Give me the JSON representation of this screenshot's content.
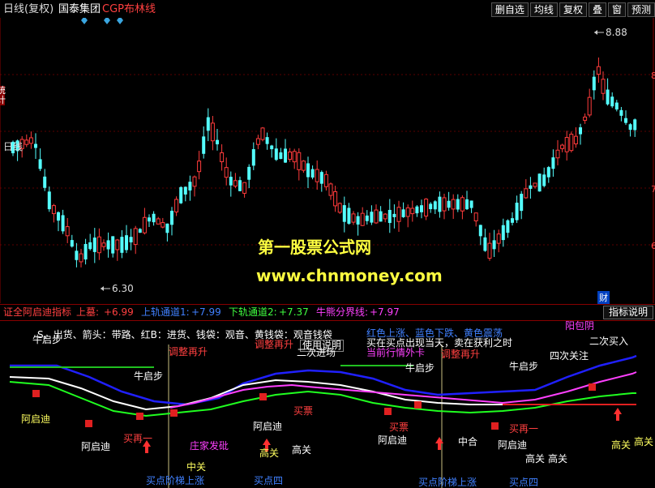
{
  "topbar": {
    "period_label": "日线(复权)",
    "stock_name": "国泰集团",
    "indicator_name": "CGP布林线",
    "toolbar": [
      "删自选",
      "均线",
      "复权",
      "叠",
      "窗",
      "预测"
    ]
  },
  "main_chart": {
    "high_label": "8.88",
    "low_label": "6.30",
    "left_edge_chars": [
      "日线",
      "统",
      "计"
    ],
    "finance_marker": "财",
    "right_ticks": [
      "8",
      "7",
      "6"
    ],
    "colors": {
      "up": "#ff3b3b",
      "down": "#54ffff"
    }
  },
  "watermark": {
    "line1": "第一股票公式网",
    "line2": "www.chnmoney.com"
  },
  "indicator_bar": {
    "name": "证全阿启迪指标",
    "upper_label": "上墓:",
    "upper_value": "+6.99",
    "ch1_label": "上轨通道1:",
    "ch1_value": "+7.99",
    "ch2_label": "下轨通道2:",
    "ch2_value": "+7.37",
    "bull_label": "牛熊分界线:",
    "bull_value": "+7.97",
    "button": "指标说明"
  },
  "sub_chart": {
    "legend_left": "S、出货、箭头：带路、红B：进货、钱袋：观音、黄钱袋：观音钱袋",
    "legend_usage": "使用说明",
    "legend_right1": "红色上涨、蓝色下跌、黄色震荡",
    "legend_right2": "买在买点出现当天，卖在获利之时",
    "legend_right3": "当前行情外卡",
    "labels": [
      {
        "t": "牛启步",
        "c": "#ffffff"
      },
      {
        "t": "调整再升",
        "c": "#ff4040"
      },
      {
        "t": "调整再升",
        "c": "#ff4040"
      },
      {
        "t": "二次进场",
        "c": "#ffffff"
      },
      {
        "t": "调整再升",
        "c": "#ff4040"
      },
      {
        "t": "阳包阴",
        "c": "#ff40ff"
      },
      {
        "t": "二次买入",
        "c": "#ffffff"
      },
      {
        "t": "四次关注",
        "c": "#ffffff"
      },
      {
        "t": "牛启步",
        "c": "#ffffff"
      },
      {
        "t": "牛启步",
        "c": "#ffffff"
      },
      {
        "t": "牛启步",
        "c": "#ffffff"
      },
      {
        "t": "阿启迪",
        "c": "#ffff60"
      },
      {
        "t": "阿启迪",
        "c": "#ffffff"
      },
      {
        "t": "买再一",
        "c": "#ff4040"
      },
      {
        "t": "庄家发砒",
        "c": "#ff40ff"
      },
      {
        "t": "买票",
        "c": "#ff4040"
      },
      {
        "t": "阿启迪",
        "c": "#ffffff"
      },
      {
        "t": "高关",
        "c": "#ffff60"
      },
      {
        "t": "高关",
        "c": "#ffffff"
      },
      {
        "t": "买票",
        "c": "#ff4040"
      },
      {
        "t": "阿启迪",
        "c": "#ffffff"
      },
      {
        "t": "中合",
        "c": "#ffffff"
      },
      {
        "t": "阿启迪",
        "c": "#ffffff"
      },
      {
        "t": "买再一",
        "c": "#ff4040"
      },
      {
        "t": "高关",
        "c": "#ffffff"
      },
      {
        "t": "高关",
        "c": "#ffffff"
      },
      {
        "t": "高关",
        "c": "#ffff60"
      },
      {
        "t": "高关",
        "c": "#ffff60"
      },
      {
        "t": "中关",
        "c": "#ffff60"
      },
      {
        "t": "买点阶梯上涨",
        "c": "#4080ff"
      },
      {
        "t": "买点四",
        "c": "#4080ff"
      },
      {
        "t": "买点阶梯上涨",
        "c": "#4080ff"
      },
      {
        "t": "买点四",
        "c": "#4080ff"
      }
    ]
  }
}
